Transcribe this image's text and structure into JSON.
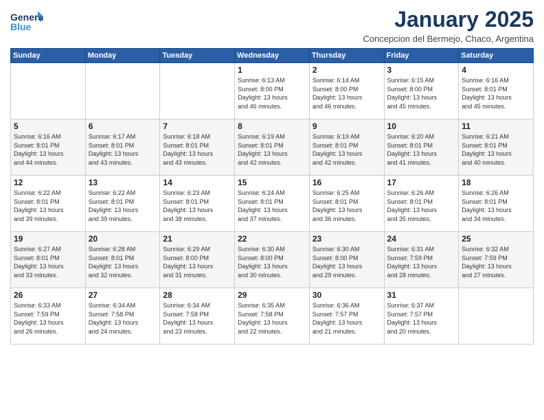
{
  "header": {
    "logo_line1": "General",
    "logo_line2": "Blue",
    "month": "January 2025",
    "location": "Concepcion del Bermejo, Chaco, Argentina"
  },
  "weekdays": [
    "Sunday",
    "Monday",
    "Tuesday",
    "Wednesday",
    "Thursday",
    "Friday",
    "Saturday"
  ],
  "weeks": [
    [
      {
        "day": "",
        "info": ""
      },
      {
        "day": "",
        "info": ""
      },
      {
        "day": "",
        "info": ""
      },
      {
        "day": "1",
        "info": "Sunrise: 6:13 AM\nSunset: 8:00 PM\nDaylight: 13 hours\nand 46 minutes."
      },
      {
        "day": "2",
        "info": "Sunrise: 6:14 AM\nSunset: 8:00 PM\nDaylight: 13 hours\nand 46 minutes."
      },
      {
        "day": "3",
        "info": "Sunrise: 6:15 AM\nSunset: 8:00 PM\nDaylight: 13 hours\nand 45 minutes."
      },
      {
        "day": "4",
        "info": "Sunrise: 6:16 AM\nSunset: 8:01 PM\nDaylight: 13 hours\nand 45 minutes."
      }
    ],
    [
      {
        "day": "5",
        "info": "Sunrise: 6:16 AM\nSunset: 8:01 PM\nDaylight: 13 hours\nand 44 minutes."
      },
      {
        "day": "6",
        "info": "Sunrise: 6:17 AM\nSunset: 8:01 PM\nDaylight: 13 hours\nand 43 minutes."
      },
      {
        "day": "7",
        "info": "Sunrise: 6:18 AM\nSunset: 8:01 PM\nDaylight: 13 hours\nand 43 minutes."
      },
      {
        "day": "8",
        "info": "Sunrise: 6:19 AM\nSunset: 8:01 PM\nDaylight: 13 hours\nand 42 minutes."
      },
      {
        "day": "9",
        "info": "Sunrise: 6:19 AM\nSunset: 8:01 PM\nDaylight: 13 hours\nand 42 minutes."
      },
      {
        "day": "10",
        "info": "Sunrise: 6:20 AM\nSunset: 8:01 PM\nDaylight: 13 hours\nand 41 minutes."
      },
      {
        "day": "11",
        "info": "Sunrise: 6:21 AM\nSunset: 8:01 PM\nDaylight: 13 hours\nand 40 minutes."
      }
    ],
    [
      {
        "day": "12",
        "info": "Sunrise: 6:22 AM\nSunset: 8:01 PM\nDaylight: 13 hours\nand 39 minutes."
      },
      {
        "day": "13",
        "info": "Sunrise: 6:22 AM\nSunset: 8:01 PM\nDaylight: 13 hours\nand 39 minutes."
      },
      {
        "day": "14",
        "info": "Sunrise: 6:23 AM\nSunset: 8:01 PM\nDaylight: 13 hours\nand 38 minutes."
      },
      {
        "day": "15",
        "info": "Sunrise: 6:24 AM\nSunset: 8:01 PM\nDaylight: 13 hours\nand 37 minutes."
      },
      {
        "day": "16",
        "info": "Sunrise: 6:25 AM\nSunset: 8:01 PM\nDaylight: 13 hours\nand 36 minutes."
      },
      {
        "day": "17",
        "info": "Sunrise: 6:26 AM\nSunset: 8:01 PM\nDaylight: 13 hours\nand 35 minutes."
      },
      {
        "day": "18",
        "info": "Sunrise: 6:26 AM\nSunset: 8:01 PM\nDaylight: 13 hours\nand 34 minutes."
      }
    ],
    [
      {
        "day": "19",
        "info": "Sunrise: 6:27 AM\nSunset: 8:01 PM\nDaylight: 13 hours\nand 33 minutes."
      },
      {
        "day": "20",
        "info": "Sunrise: 6:28 AM\nSunset: 8:01 PM\nDaylight: 13 hours\nand 32 minutes."
      },
      {
        "day": "21",
        "info": "Sunrise: 6:29 AM\nSunset: 8:00 PM\nDaylight: 13 hours\nand 31 minutes."
      },
      {
        "day": "22",
        "info": "Sunrise: 6:30 AM\nSunset: 8:00 PM\nDaylight: 13 hours\nand 30 minutes."
      },
      {
        "day": "23",
        "info": "Sunrise: 6:30 AM\nSunset: 8:00 PM\nDaylight: 13 hours\nand 29 minutes."
      },
      {
        "day": "24",
        "info": "Sunrise: 6:31 AM\nSunset: 7:59 PM\nDaylight: 13 hours\nand 28 minutes."
      },
      {
        "day": "25",
        "info": "Sunrise: 6:32 AM\nSunset: 7:59 PM\nDaylight: 13 hours\nand 27 minutes."
      }
    ],
    [
      {
        "day": "26",
        "info": "Sunrise: 6:33 AM\nSunset: 7:59 PM\nDaylight: 13 hours\nand 26 minutes."
      },
      {
        "day": "27",
        "info": "Sunrise: 6:34 AM\nSunset: 7:58 PM\nDaylight: 13 hours\nand 24 minutes."
      },
      {
        "day": "28",
        "info": "Sunrise: 6:34 AM\nSunset: 7:58 PM\nDaylight: 13 hours\nand 23 minutes."
      },
      {
        "day": "29",
        "info": "Sunrise: 6:35 AM\nSunset: 7:58 PM\nDaylight: 13 hours\nand 22 minutes."
      },
      {
        "day": "30",
        "info": "Sunrise: 6:36 AM\nSunset: 7:57 PM\nDaylight: 13 hours\nand 21 minutes."
      },
      {
        "day": "31",
        "info": "Sunrise: 6:37 AM\nSunset: 7:57 PM\nDaylight: 13 hours\nand 20 minutes."
      },
      {
        "day": "",
        "info": ""
      }
    ]
  ]
}
